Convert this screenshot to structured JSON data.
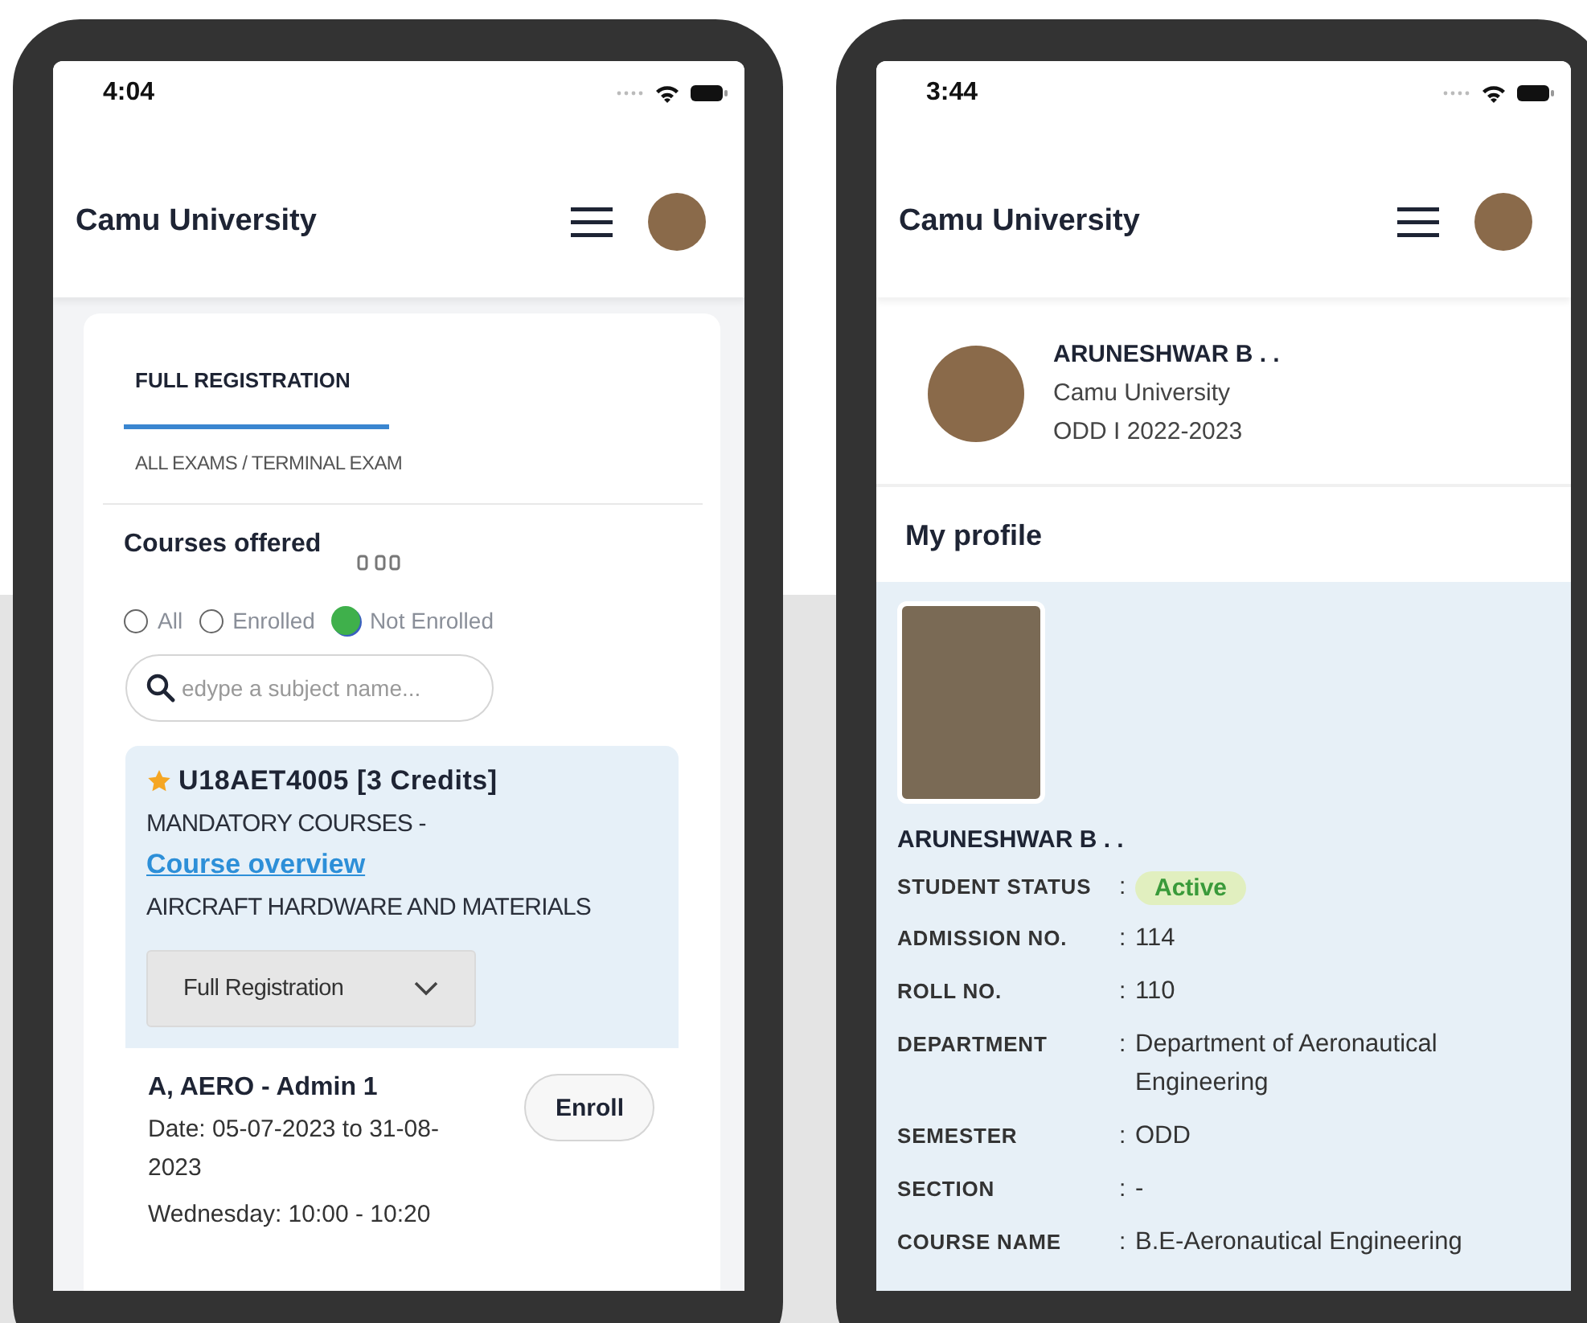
{
  "left_phone": {
    "status_time": "4:04",
    "header_title": "Camu University",
    "tabs": [
      {
        "label": "FULL REGISTRATION",
        "selected": true
      }
    ],
    "breadcrumb": "ALL EXAMS / TERMINAL EXAM",
    "section_title": "Courses offered",
    "filters": [
      {
        "label": "All",
        "selected": false
      },
      {
        "label": "Enrolled",
        "selected": false
      },
      {
        "label": "Not Enrolled",
        "selected": true
      }
    ],
    "search": {
      "placeholder": "edype a subject name..."
    },
    "course": {
      "starred": true,
      "code": "U18AET4005 [3 Credits]",
      "category": "MANDATORY COURSES -",
      "link": "Course overview",
      "name": "AIRCRAFT HARDWARE AND MATERIALS",
      "dropdown": "Full Registration"
    },
    "batch": {
      "title": "A, AERO - Admin 1",
      "date": "Date: 05-07-2023 to 31-08-2023",
      "schedule": "Wednesday: 10:00 - 10:20",
      "button": "Enroll"
    }
  },
  "right_phone": {
    "status_time": "3:44",
    "header_title": "Camu University",
    "profile_card": {
      "name": "ARUNESHWAR B . .",
      "university": "Camu University",
      "term": "ODD I 2022-2023"
    },
    "section_title": "My profile",
    "details_name": "ARUNESHWAR B . .",
    "fields": [
      {
        "label": "STUDENT STATUS",
        "separator": ":",
        "value": "Active",
        "kind": "badge"
      },
      {
        "label": "ADMISSION NO.",
        "separator": ":",
        "value": "114",
        "kind": "text"
      },
      {
        "label": "ROLL NO.",
        "separator": ":",
        "value": "110",
        "kind": "text"
      },
      {
        "label": "DEPARTMENT",
        "separator": ":",
        "value": "Department of Aeronautical Engineering",
        "kind": "text"
      },
      {
        "label": "SEMESTER",
        "separator": ":",
        "value": "ODD",
        "kind": "text"
      },
      {
        "label": "SECTION",
        "separator": ":",
        "value": "-",
        "kind": "text"
      },
      {
        "label": "COURSE NAME",
        "separator": ":",
        "value": "B.E-Aeronautical Engineering",
        "kind": "text"
      }
    ]
  }
}
